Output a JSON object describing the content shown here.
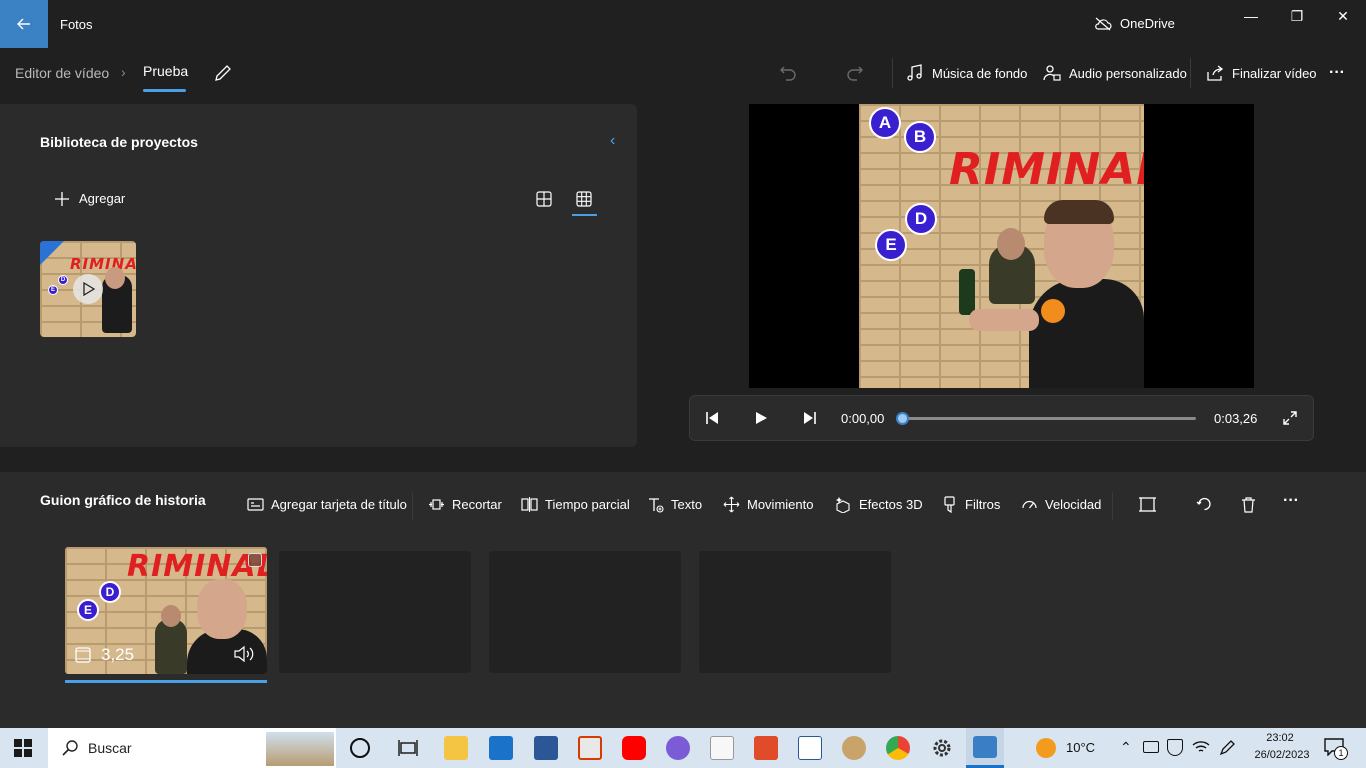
{
  "app": {
    "title": "Fotos",
    "onedrive_label": "OneDrive"
  },
  "window_controls": {
    "minimize": "—",
    "maximize": "❐",
    "close": "✕"
  },
  "breadcrumb": {
    "editor": "Editor de vídeo",
    "separator": "›",
    "project": "Prueba"
  },
  "commands": {
    "music": "Música de fondo",
    "custom_audio": "Audio personalizado",
    "finish": "Finalizar vídeo",
    "more": "···"
  },
  "library": {
    "title": "Biblioteca de proyectos",
    "add_label": "Agregar",
    "collapse": "‹"
  },
  "media": {
    "title_text": "RIMINAL",
    "bubbles": [
      "A",
      "B",
      "D",
      "E"
    ]
  },
  "player": {
    "current_time": "0:00,00",
    "total_time": "0:03,26",
    "progress": 0
  },
  "storyboard": {
    "title": "Guion gráfico de historia",
    "tools": {
      "title_card": "Agregar tarjeta de título",
      "trim": "Recortar",
      "split": "Tiempo parcial",
      "text": "Texto",
      "motion": "Movimiento",
      "effects3d": "Efectos 3D",
      "filters": "Filtros",
      "speed": "Velocidad",
      "more": "···"
    },
    "clip": {
      "duration": "3,25"
    }
  },
  "taskbar": {
    "search_label": "Buscar",
    "temperature": "10°C",
    "time": "23:02",
    "date": "26/02/2023",
    "notification_count": "1"
  },
  "colors": {
    "accent": "#3b82c4",
    "panel": "#2b2b2b",
    "background": "#202020",
    "link": "#4aa0e6"
  }
}
